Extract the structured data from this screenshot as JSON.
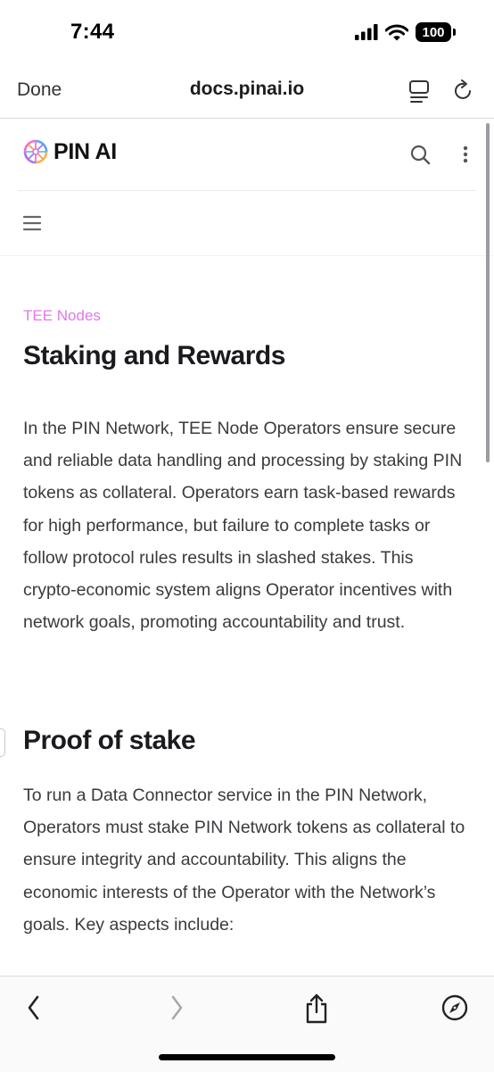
{
  "status_bar": {
    "time": "7:44",
    "battery": "100"
  },
  "browser": {
    "done_label": "Done",
    "url": "docs.pinai.io"
  },
  "site": {
    "logo_text": "PIN AI"
  },
  "content": {
    "breadcrumb": "TEE Nodes",
    "title": "Staking and Rewards",
    "intro": "In the PIN Network, TEE Node Operators ensure secure and reliable data handling and processing by staking PIN tokens as collateral. Operators earn task-based rewards for high performance, but failure to complete tasks or follow protocol rules results in slashed stakes. This crypto-economic system aligns Operator incentives with network goals, promoting accountability and trust.",
    "section_title": "Proof of stake",
    "section_paragraph": "To run a Data Connector service in the PIN Network, Operators must stake PIN Network tokens as collateral to ensure integrity and accountability. This aligns the economic interests of the Operator with the Network’s goals. Key aspects include:"
  },
  "icons": {
    "signal": "cellular-signal-icon",
    "wifi": "wifi-icon",
    "reader": "reader-mode-icon",
    "reload": "reload-icon",
    "logo": "pin-ai-logo",
    "search": "search-icon",
    "more": "more-vertical-icon",
    "menu": "hamburger-menu-icon",
    "back": "chevron-left-icon",
    "forward": "chevron-right-icon",
    "share": "share-icon",
    "safari": "compass-icon"
  },
  "colors": {
    "breadcrumb": "#e178e8",
    "heading": "#1a1a1f",
    "body_text": "#3a3a3f"
  }
}
